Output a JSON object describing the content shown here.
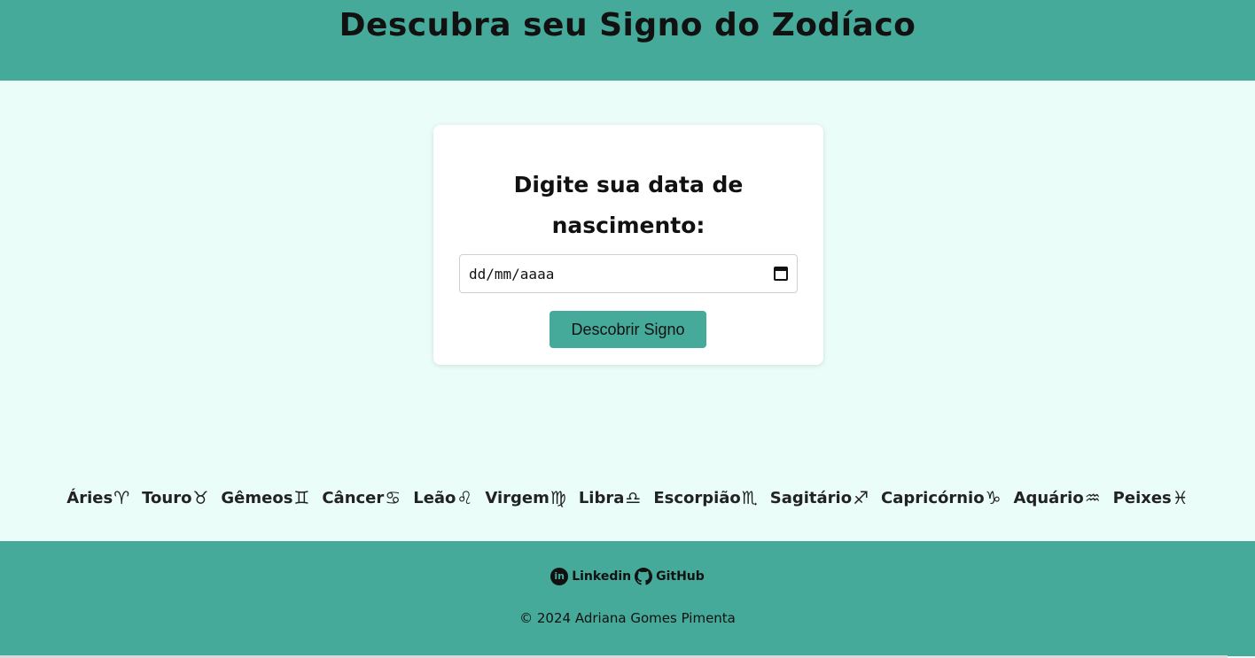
{
  "header": {
    "title": "Descubra seu Signo do Zodíaco"
  },
  "form": {
    "heading": "Digite sua data de nascimento:",
    "date_placeholder": "dd/mm/aaaa",
    "submit_label": "Descobrir Signo"
  },
  "signs": [
    {
      "label": "Áries",
      "glyph": "♈︎"
    },
    {
      "label": "Touro",
      "glyph": "♉︎"
    },
    {
      "label": "Gêmeos",
      "glyph": "♊︎"
    },
    {
      "label": "Câncer",
      "glyph": "♋︎"
    },
    {
      "label": "Leão",
      "glyph": "♌︎"
    },
    {
      "label": "Virgem",
      "glyph": "♍︎"
    },
    {
      "label": "Libra",
      "glyph": "♎︎"
    },
    {
      "label": "Escorpião",
      "glyph": "♏︎"
    },
    {
      "label": "Sagitário",
      "glyph": "♐︎"
    },
    {
      "label": "Capricórnio",
      "glyph": "♑︎"
    },
    {
      "label": "Aquário",
      "glyph": "♒︎"
    },
    {
      "label": "Peixes",
      "glyph": "♓︎"
    }
  ],
  "footer": {
    "linkedin_label": "Linkedin",
    "linkedin_icon": "linkedin-icon",
    "github_label": "GitHub",
    "github_icon": "github-icon",
    "copyright": "© 2024 Adriana Gomes Pimenta"
  },
  "colors": {
    "accent": "#45aa9a",
    "background": "#ebfdf9",
    "card": "#ffffff"
  }
}
